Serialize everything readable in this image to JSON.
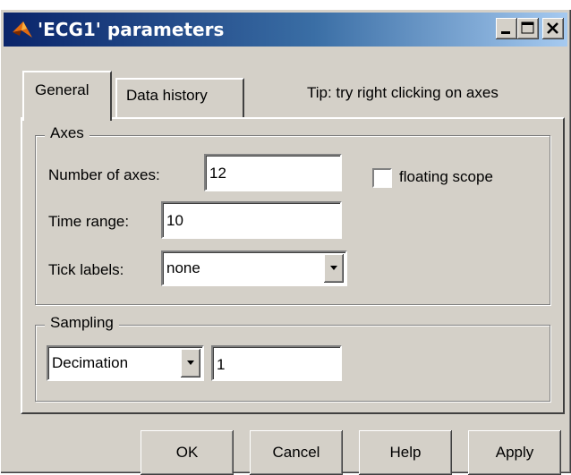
{
  "window": {
    "title": "'ECG1' parameters",
    "titlebar_colors": [
      "#0a246a",
      "#a6caf0"
    ],
    "controls": [
      "minimize-icon",
      "maximize-icon",
      "close-icon"
    ]
  },
  "tabs": [
    {
      "label": "General",
      "selected": true
    },
    {
      "label": "Data history",
      "selected": false
    }
  ],
  "tip": "Tip: try right clicking on axes",
  "axes_group": {
    "legend": "Axes",
    "number_of_axes_label": "Number of axes:",
    "number_of_axes_value": "12",
    "floating_scope_label": "floating scope",
    "floating_scope_checked": false,
    "time_range_label": "Time range:",
    "time_range_value": "10",
    "tick_labels_label": "Tick labels:",
    "tick_labels_value": "none"
  },
  "sampling_group": {
    "legend": "Sampling",
    "mode_value": "Decimation",
    "factor_value": "1"
  },
  "buttons": {
    "ok": "OK",
    "cancel": "Cancel",
    "help": "Help",
    "apply": "Apply"
  }
}
